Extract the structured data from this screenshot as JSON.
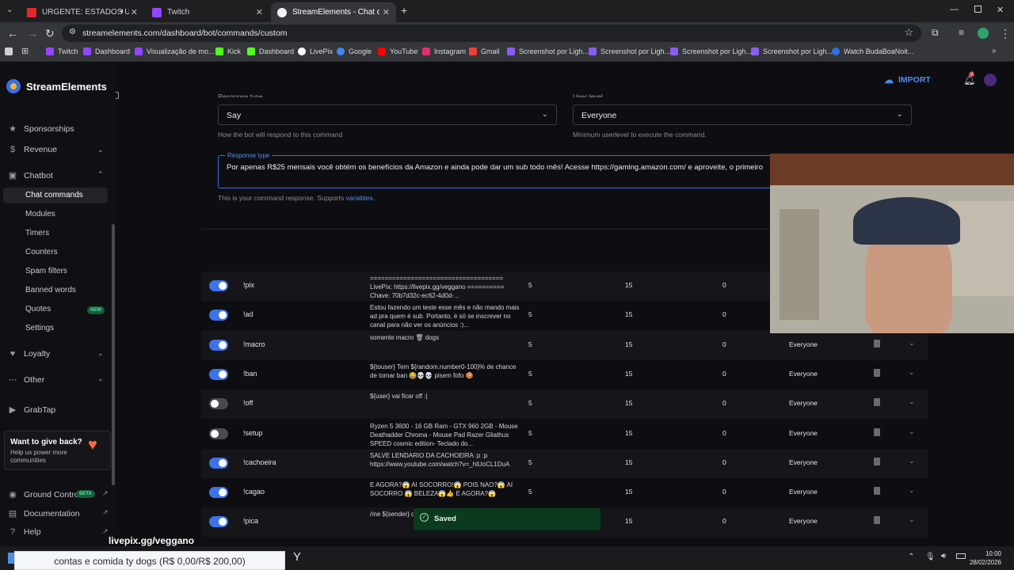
{
  "browser": {
    "tabs": [
      {
        "label": "URGENTE: ESTADOS UNIDO",
        "favicon_color": "#e4262c"
      },
      {
        "label": "Twitch",
        "favicon_color": "#9146ff"
      },
      {
        "label": "StreamElements - Chat comma",
        "favicon_color": "#1a1a1a"
      }
    ],
    "url": "streamelements.com/dashboard/bot/commands/custom",
    "bookmarks": [
      {
        "label": "Twitch",
        "color": "#9146ff"
      },
      {
        "label": "Dashboard",
        "color": "#9146ff"
      },
      {
        "label": "Visualização de mo...",
        "color": "#9146ff"
      },
      {
        "label": "Kick",
        "color": "#53fc18"
      },
      {
        "label": "Dashboard",
        "color": "#53fc18"
      },
      {
        "label": "LivePix",
        "color": "#ffffff"
      },
      {
        "label": "Google",
        "color": "#4285f4"
      },
      {
        "label": "YouTube",
        "color": "#ff0000"
      },
      {
        "label": "Instagram",
        "color": "#e1306c"
      },
      {
        "label": "Gmail",
        "color": "#ea4335"
      },
      {
        "label": "Screenshot por Ligh...",
        "color": "#8a5cf5"
      },
      {
        "label": "Screenshot por Ligh...",
        "color": "#8a5cf5"
      },
      {
        "label": "Screenshot por Ligh...",
        "color": "#8a5cf5"
      },
      {
        "label": "Screenshot por Ligh...",
        "color": "#8a5cf5"
      },
      {
        "label": "Watch BudaBoaNoit...",
        "color": "#2f6fe4"
      }
    ]
  },
  "app": {
    "brand": "StreamElements",
    "import_label": "IMPORT",
    "notif_count": "2"
  },
  "sidebar": {
    "sponsorships": "Sponsorships",
    "revenue": "Revenue",
    "chatbot": "Chatbot",
    "chatbot_items": [
      "Chat commands",
      "Modules",
      "Timers",
      "Counters",
      "Spam filters",
      "Banned words",
      "Quotes",
      "Settings"
    ],
    "new_badge": "NEW",
    "loyalty": "Loyalty",
    "other": "Other",
    "grabtap": "GrabTap",
    "promo_title": "Want to give back?",
    "promo_text": "Help us power more communities",
    "ground_control": "Ground Control",
    "beta_badge": "BETA",
    "documentation": "Documentation",
    "help": "Help"
  },
  "form": {
    "response_type_label": "Response type",
    "response_type_value": "Say",
    "response_type_hint": "How the bot will respond to this command",
    "user_level_label": "User level",
    "user_level_value": "Everyone",
    "user_level_hint": "Minimum userlevel to execute the command.",
    "response_label": "Response type",
    "response_text": "Por apenas R$25 mensais você obtém os benefícios da Amazon e ainda pode dar um sub todo mês! Acesse https://gaming.amazon.com/ e aproveite, o primeiro",
    "response_hint_prefix": "This is your command response. Supports",
    "response_hint_link": "variables."
  },
  "commands": [
    {
      "enabled": true,
      "name": "!pix",
      "response": "==================================== LivePix: https://livepix.gg/veggano ========== Chave: 70b7d32c-ec62-4d0d-...",
      "cost": "5",
      "cooldown": "15",
      "uses": "0",
      "userlevel": ""
    },
    {
      "enabled": true,
      "name": "!ad",
      "response": "Estou fazendo um teste esse mês e não mando mais ad pra quem é sub. Portanto, é só se inscrever no canal para não ver os anúncios :)...",
      "cost": "5",
      "cooldown": "15",
      "uses": "0",
      "userlevel": ""
    },
    {
      "enabled": true,
      "name": "!macro",
      "response": "somente macro 🗑 dogs",
      "cost": "5",
      "cooldown": "15",
      "uses": "0",
      "userlevel": "Everyone"
    },
    {
      "enabled": true,
      "name": "!ban",
      "response": "${touser} Tem ${random.number0-100}% de chance de tomar ban 😂💀💀 pisem fofo 🍪",
      "cost": "5",
      "cooldown": "15",
      "uses": "0",
      "userlevel": "Everyone"
    },
    {
      "enabled": false,
      "name": "!off",
      "response": "${user} vai ficar off :|",
      "cost": "5",
      "cooldown": "15",
      "uses": "0",
      "userlevel": "Everyone"
    },
    {
      "enabled": false,
      "name": "!setup",
      "response": "Ryzen 5 3600 - 16 GB Ram - GTX 960 2GB - Mouse Deathadder Chroma - Mouse Pad Razer Gliathus SPEED cosmic edition- Teclado do...",
      "cost": "5",
      "cooldown": "15",
      "uses": "0",
      "userlevel": "Everyone"
    },
    {
      "enabled": true,
      "name": "!cachoeira",
      "response": "SALVE LENDARIO DA CACHOEIRA :p :p https://www.youtube.com/watch?v=_hlUoCL1DuA",
      "cost": "5",
      "cooldown": "15",
      "uses": "0",
      "userlevel": "Everyone"
    },
    {
      "enabled": true,
      "name": "!cagao",
      "response": "E AGORA?😱 AI SOCORRO!😱 POIS NAO?😱 AI SOCORRO 😱 BELEZA😱👍 E AGORA?😱",
      "cost": "5",
      "cooldown": "15",
      "uses": "0",
      "userlevel": "Everyone"
    },
    {
      "enabled": true,
      "name": "!pica",
      "response": "/me ${sender} de pica! 🔪",
      "cost": "",
      "cooldown": "15",
      "uses": "0",
      "userlevel": "Everyone"
    }
  ],
  "toast": {
    "text": "Saved"
  },
  "overlay": {
    "livepix_watermark": "livepix.gg/veggano",
    "ticker": "contas e comida ty dogs (R$ 0,00/R$ 200,00)"
  },
  "taskbar": {
    "time": "10:00",
    "date": "28/02/2026"
  }
}
